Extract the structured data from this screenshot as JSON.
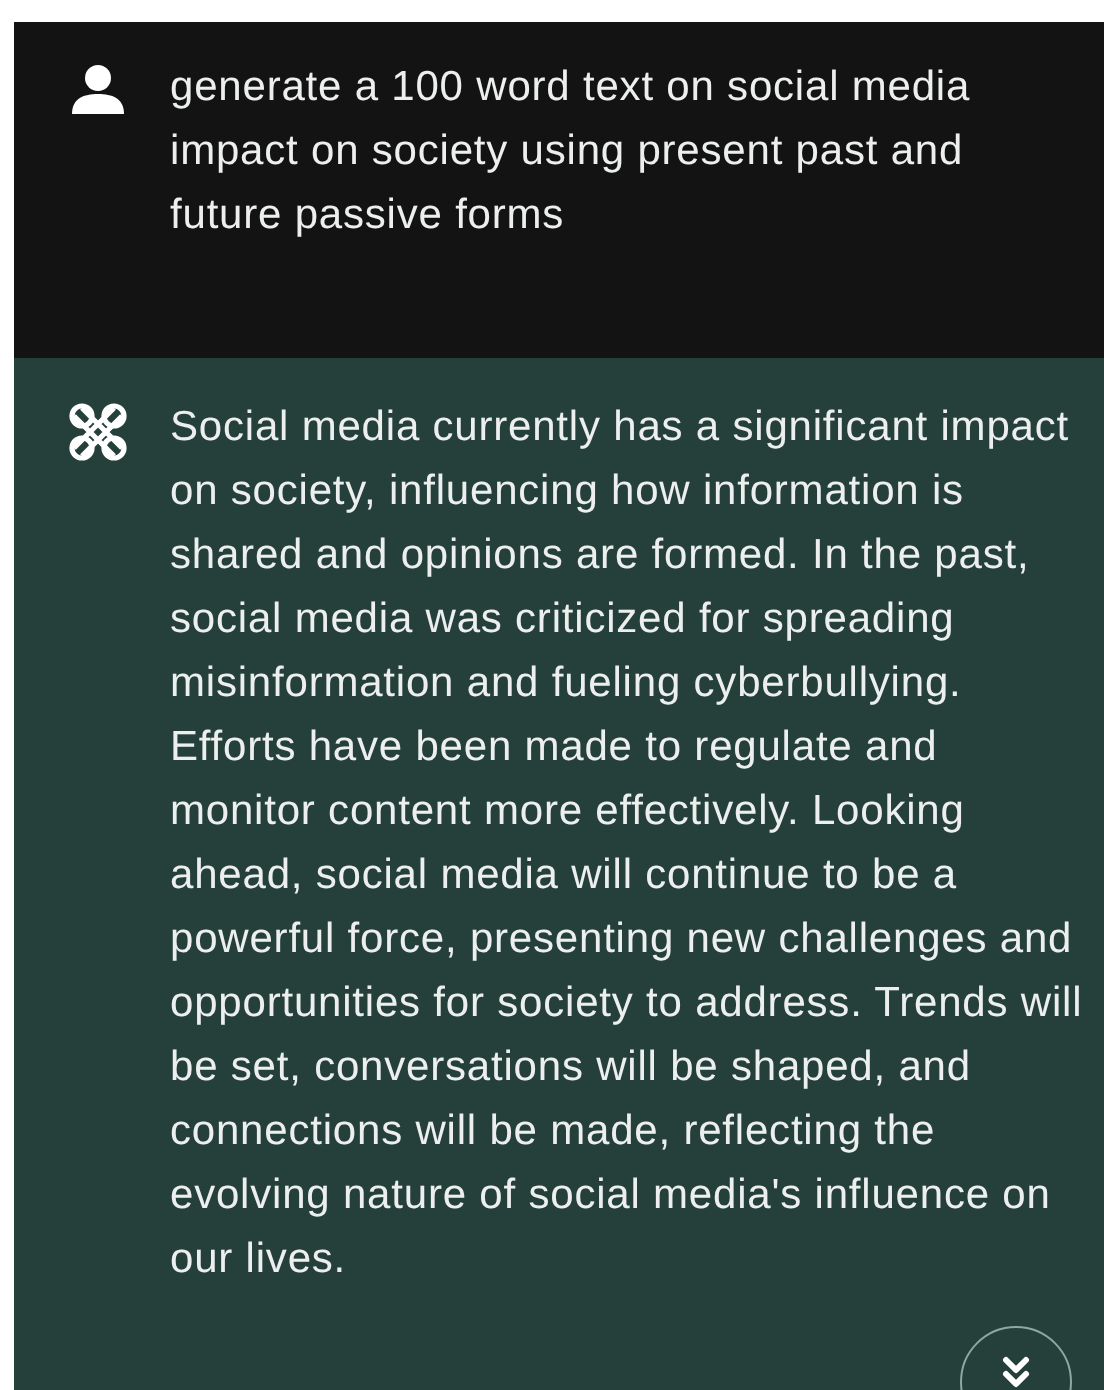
{
  "messages": [
    {
      "kind": "user",
      "text": "generate a 100 word text on social media impact on society using present past and future passive forms"
    },
    {
      "kind": "assistant",
      "text": "Social media currently has a significant impact on society, influencing how information is shared and opinions are formed. In the past, social media was criticized for spreading misinformation and fueling cyberbullying. Efforts have been made to regulate and monitor content more effectively. Looking ahead, social media will continue to be a powerful force, presenting new challenges and opportunities for society to address. Trends will be set, conversations will be shaped, and connections will be made, reflecting the evolving nature of social media's influence on our lives."
    }
  ]
}
